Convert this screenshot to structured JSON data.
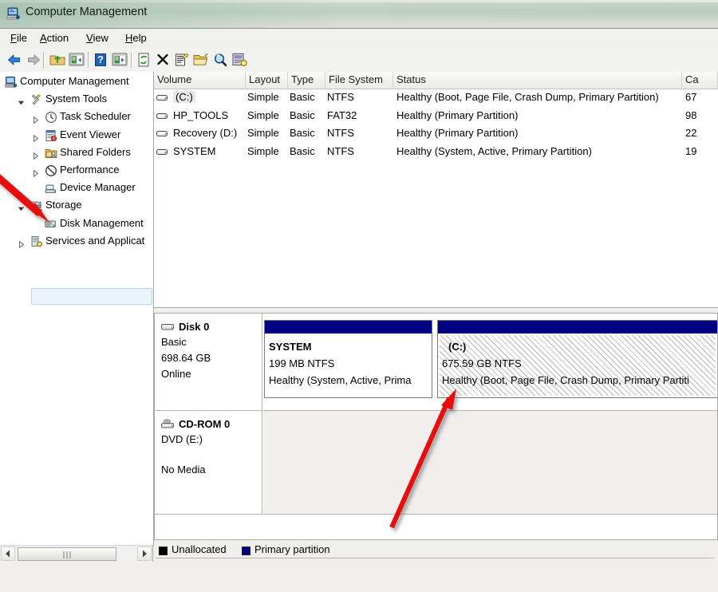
{
  "window": {
    "title": "Computer Management",
    "title_icon": "computer-management-icon"
  },
  "menubar": {
    "items": [
      {
        "label": "File",
        "accel": "F"
      },
      {
        "label": "Action",
        "accel": "A"
      },
      {
        "label": "View",
        "accel": "V"
      },
      {
        "label": "Help",
        "accel": "H"
      }
    ]
  },
  "toolbar": {
    "buttons": [
      {
        "name": "back-icon",
        "tip": "Back"
      },
      {
        "name": "forward-icon",
        "tip": "Forward"
      },
      {
        "name": "up-folder-icon",
        "tip": "Up One Level"
      },
      {
        "name": "show-hide-tree-icon",
        "tip": "Show/Hide Console Tree"
      },
      {
        "name": "help-icon",
        "tip": "Help"
      },
      {
        "name": "show-action-pane-icon",
        "tip": "Show/Hide Action Pane"
      },
      {
        "name": "refresh-icon",
        "tip": "Refresh"
      },
      {
        "name": "delete-icon",
        "tip": "Delete"
      },
      {
        "name": "properties-icon",
        "tip": "Properties"
      },
      {
        "name": "open-folder-icon",
        "tip": "Open"
      },
      {
        "name": "search-icon",
        "tip": "Search"
      },
      {
        "name": "rescan-disks-icon",
        "tip": "Rescan Disks"
      }
    ]
  },
  "tree": {
    "items": [
      {
        "label": "Computer Management",
        "depth": 0,
        "expander": "none",
        "icon": "computer-icon",
        "selected": false
      },
      {
        "label": "System Tools",
        "depth": 1,
        "expander": "expanded",
        "icon": "system-tools-icon",
        "selected": false
      },
      {
        "label": "Task Scheduler",
        "depth": 2,
        "expander": "collapsed",
        "icon": "clock-icon",
        "selected": false
      },
      {
        "label": "Event Viewer",
        "depth": 2,
        "expander": "collapsed",
        "icon": "event-viewer-icon",
        "selected": false
      },
      {
        "label": "Shared Folders",
        "depth": 2,
        "expander": "collapsed",
        "icon": "shared-folders-icon",
        "selected": false
      },
      {
        "label": "Performance",
        "depth": 2,
        "expander": "collapsed",
        "icon": "performance-icon",
        "selected": false
      },
      {
        "label": "Device Manager",
        "depth": 2,
        "expander": "none",
        "icon": "device-manager-icon",
        "selected": false
      },
      {
        "label": "Storage",
        "depth": 1,
        "expander": "expanded",
        "icon": "storage-icon",
        "selected": false
      },
      {
        "label": "Disk Management",
        "depth": 2,
        "expander": "none",
        "icon": "disk-management-icon",
        "selected": true
      },
      {
        "label": "Services and Applicat",
        "depth": 1,
        "expander": "collapsed",
        "icon": "services-icon",
        "selected": false
      }
    ]
  },
  "volume_list": {
    "columns": [
      "Volume",
      "Layout",
      "Type",
      "File System",
      "Status",
      "Ca"
    ],
    "rows": [
      {
        "volume": "(C:)",
        "layout": "Simple",
        "type": "Basic",
        "filesystem": "NTFS",
        "status": "Healthy (Boot, Page File, Crash Dump, Primary Partition)",
        "capacity": "67",
        "selected": true
      },
      {
        "volume": "HP_TOOLS",
        "layout": "Simple",
        "type": "Basic",
        "filesystem": "FAT32",
        "status": "Healthy (Primary Partition)",
        "capacity": "98",
        "selected": false
      },
      {
        "volume": "Recovery (D:)",
        "layout": "Simple",
        "type": "Basic",
        "filesystem": "NTFS",
        "status": "Healthy (Primary Partition)",
        "capacity": "22",
        "selected": false
      },
      {
        "volume": "SYSTEM",
        "layout": "Simple",
        "type": "Basic",
        "filesystem": "NTFS",
        "status": "Healthy (System, Active, Primary Partition)",
        "capacity": "19",
        "selected": false
      }
    ]
  },
  "disk_view": {
    "disks": [
      {
        "name": "Disk 0",
        "icon": "hard-disk-icon",
        "line1": "Basic",
        "line2": "698.64 GB",
        "line3": "Online",
        "partitions": [
          {
            "name": "SYSTEM",
            "size": "199 MB NTFS",
            "status": "Healthy (System, Active, Prima",
            "selected": false,
            "bar_color": "#000080"
          },
          {
            "name": "(C:)",
            "size": "675.59 GB NTFS",
            "status": "Healthy (Boot, Page File, Crash Dump, Primary Partiti",
            "selected": true,
            "bar_color": "#000080"
          }
        ]
      },
      {
        "name": "CD-ROM 0",
        "icon": "cdrom-icon",
        "line1": "DVD (E:)",
        "line2": "",
        "line3": "No Media",
        "partitions": []
      }
    ]
  },
  "legend": {
    "items": [
      {
        "label": "Unallocated",
        "color": "#000000"
      },
      {
        "label": "Primary partition",
        "color": "#000080"
      }
    ]
  },
  "annotations": [
    {
      "name": "arrow-pointing-to-disk-management",
      "color": "#e8100f"
    },
    {
      "name": "arrow-pointing-to-c-partition",
      "color": "#e8100f"
    }
  ]
}
